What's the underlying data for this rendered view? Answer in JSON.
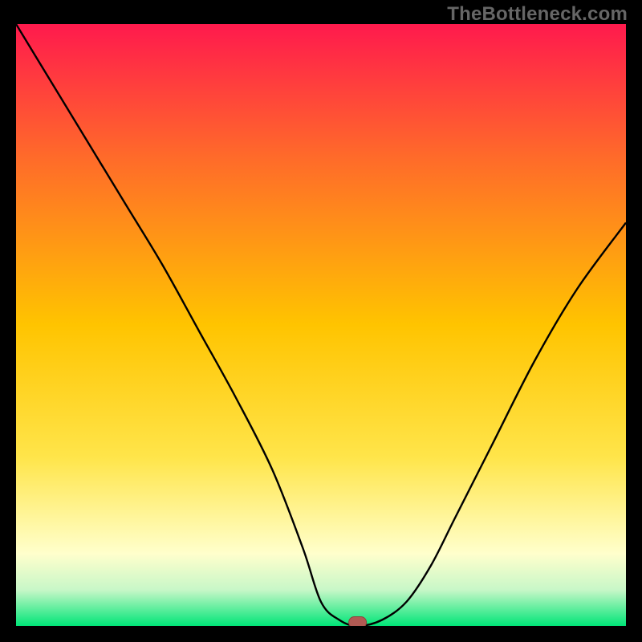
{
  "watermark": "TheBottleneck.com",
  "colors": {
    "frame": "#000000",
    "watermark_text": "#666666",
    "curve": "#000000",
    "marker_fill": "#b15a53",
    "marker_stroke": "#8e423c",
    "grad_top": "#ff1a4d",
    "grad_mid_upper": "#ff6a2a",
    "grad_mid": "#ffc400",
    "grad_mid_lower": "#ffe54a",
    "grad_pale": "#ffffcc",
    "grad_green_pale": "#c8f7c8",
    "grad_green": "#00e577"
  },
  "chart_data": {
    "type": "line",
    "title": "",
    "xlabel": "",
    "ylabel": "",
    "xlim": [
      0,
      100
    ],
    "ylim": [
      0,
      100
    ],
    "grid": false,
    "legend": false,
    "series": [
      {
        "name": "bottleneck-curve",
        "x": [
          0,
          6,
          12,
          18,
          24,
          30,
          36,
          42,
          47,
          50,
          53,
          56,
          60,
          64,
          68,
          72,
          78,
          85,
          92,
          100
        ],
        "y": [
          100,
          90,
          80,
          70,
          60,
          49,
          38,
          26,
          13,
          4,
          1,
          0,
          1,
          4,
          10,
          18,
          30,
          44,
          56,
          67
        ]
      }
    ],
    "marker": {
      "x": 56,
      "y": 0.6
    },
    "gradient_stops": [
      {
        "offset": 0.0,
        "color": "#ff1a4d"
      },
      {
        "offset": 0.22,
        "color": "#ff6a2a"
      },
      {
        "offset": 0.5,
        "color": "#ffc400"
      },
      {
        "offset": 0.72,
        "color": "#ffe54a"
      },
      {
        "offset": 0.88,
        "color": "#ffffcc"
      },
      {
        "offset": 0.94,
        "color": "#c8f7c8"
      },
      {
        "offset": 1.0,
        "color": "#00e577"
      }
    ]
  }
}
